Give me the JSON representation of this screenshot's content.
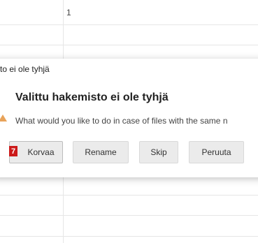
{
  "background": {
    "column_number": "1"
  },
  "dialog": {
    "title": "to ei ole tyhjä",
    "heading": "Valittu hakemisto ei ole tyhjä",
    "message": "What would you like to do in case of files with the same n",
    "buttons": {
      "replace": {
        "label": "Korvaa",
        "badge": "7"
      },
      "rename": {
        "label": "Rename"
      },
      "skip": {
        "label": "Skip"
      },
      "cancel": {
        "label": "Peruuta"
      }
    }
  },
  "colors": {
    "badge": "#cc1a1a",
    "warning": "#e8a35a",
    "button_bg": "#ebebeb"
  },
  "icons": {
    "warning": "warning-icon"
  }
}
